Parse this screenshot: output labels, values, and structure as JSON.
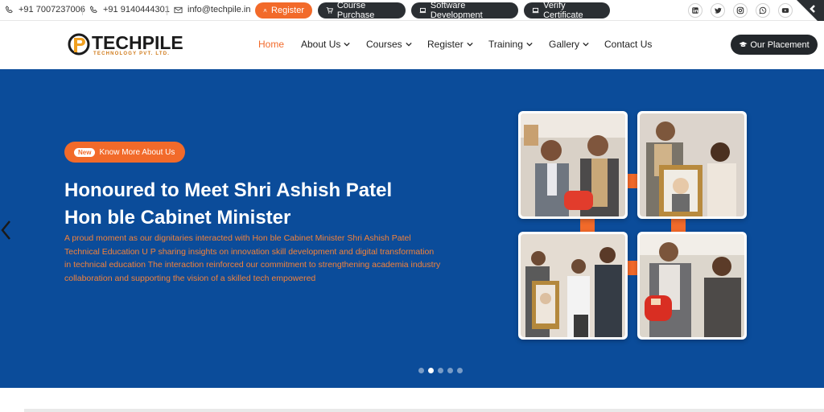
{
  "topbar": {
    "phone1": "+91 7007237006",
    "phone2": "+91 9140444301",
    "email": "info@techpile.in",
    "register_label": "Register",
    "course_purchase_label": "Course Purchase",
    "software_dev_label": "Software Development",
    "verify_certificate_label": "Verify Certificate",
    "socials": [
      "linkedin-icon",
      "twitter-icon",
      "instagram-icon",
      "whatsapp-icon",
      "youtube-icon"
    ]
  },
  "nav": {
    "logo_text": "TECHPILE",
    "logo_sub": "TECHNOLOGY PVT. LTD.",
    "items": [
      {
        "label": "Home",
        "active": true
      },
      {
        "label": "About Us",
        "dropdown": true
      },
      {
        "label": "Courses",
        "dropdown": true
      },
      {
        "label": "Register",
        "dropdown": true
      },
      {
        "label": "Training",
        "dropdown": true
      },
      {
        "label": "Gallery",
        "dropdown": true
      },
      {
        "label": "Contact Us"
      }
    ],
    "placement_label": "Our Placement"
  },
  "hero": {
    "badge_new": "New",
    "badge_label": "Know More About Us",
    "title_line1": "Honoured to Meet Shri Ashish Patel",
    "title_line2": "Hon ble Cabinet Minister",
    "description": "A proud moment as our dignitaries interacted with Hon ble Cabinet Minister Shri Ashish Patel Technical Education U P sharing insights on innovation skill development and digital transformation in technical education The interaction reinforced our commitment to strengthening academia industry collaboration and supporting the vision of a skilled tech empowered",
    "slides_count": 5,
    "active_slide": 2
  },
  "colors": {
    "brand_orange": "#f26a2a",
    "hero_blue": "#0b4c9a",
    "dark": "#2b2f33"
  }
}
